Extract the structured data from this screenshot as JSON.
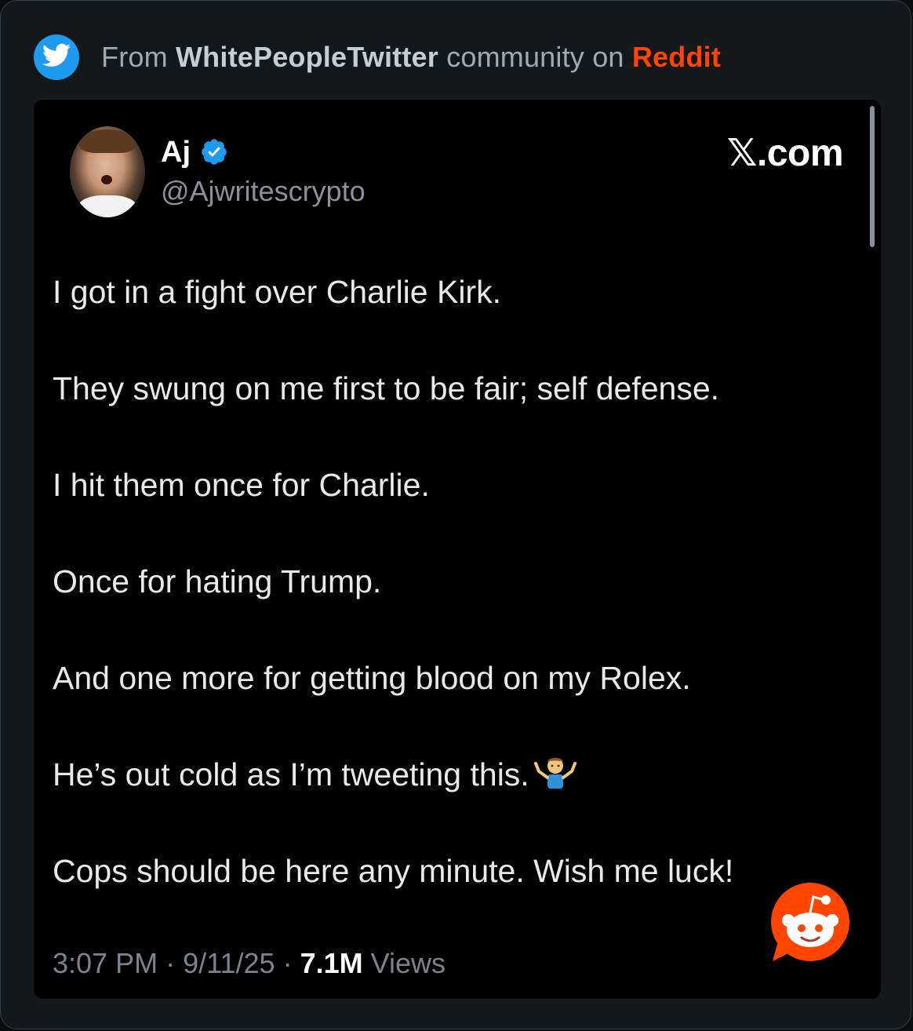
{
  "source": {
    "prefix": "From",
    "community": "WhitePeopleTwitter",
    "middle": "community on",
    "platform": "Reddit",
    "community_icon": "twitter-bird-icon"
  },
  "tweet": {
    "author_name": "Aj",
    "verified": true,
    "handle": "@Ajwritescrypto",
    "platform_label": "𝕏.com",
    "lines": [
      "I got in a fight over Charlie Kirk.",
      "They swung on me first to be fair; self defense.",
      "I hit them once for Charlie.",
      "Once for hating Trump.",
      "And one more for getting blood on my Rolex.",
      "He’s out cold as I’m tweeting this.",
      "Cops should be here any minute. Wish me luck!"
    ],
    "emoji": "shrug-emoji",
    "time": "3:07 PM",
    "date": "9/11/25",
    "views_count": "7.1M",
    "views_label": "Views",
    "separator": "·"
  },
  "colors": {
    "accent": "#1d9bf0",
    "reddit": "#ff4500",
    "background": "#000000"
  }
}
